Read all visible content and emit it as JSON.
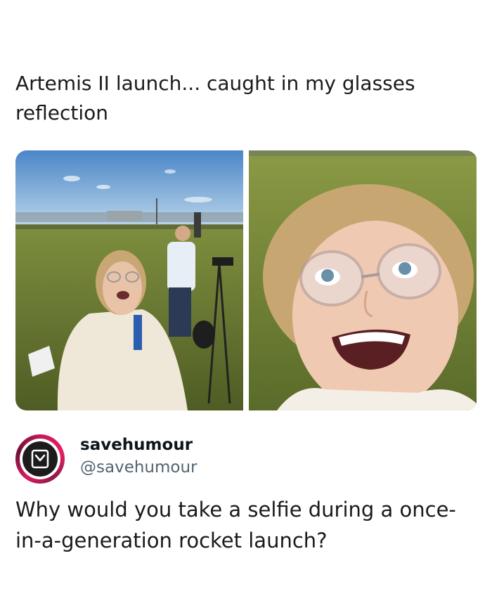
{
  "post": {
    "caption": "Artemis II launch... caught in my glasses reflection",
    "images": [
      {
        "icon": "selfie-with-crowd-photo"
      },
      {
        "icon": "closeup-selfie-glasses-photo"
      }
    ]
  },
  "author": {
    "name": "savehumour",
    "handle": "@savehumour",
    "avatar_icon": "bookmark-icon",
    "brand_color": "#c2185b"
  },
  "tweet": {
    "text": "Why would you take a selfie during a once-in-a-generation rocket launch?"
  }
}
